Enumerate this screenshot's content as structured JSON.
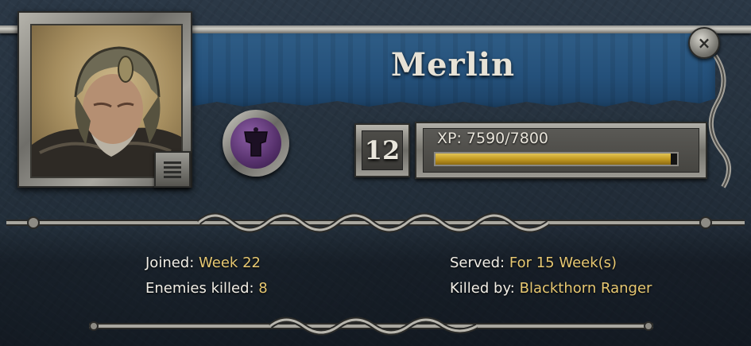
{
  "hero": {
    "name": "Merlin",
    "level": "12",
    "xp_label": "XP: 7590/7800",
    "xp_current": 7590,
    "xp_max": 7800,
    "xp_fraction": 0.973,
    "class_icon": "mage-robe-icon"
  },
  "stats": {
    "joined_label": "Joined:",
    "joined_value": "Week 22",
    "enemies_label": "Enemies killed:",
    "enemies_value": "8",
    "served_label": "Served:",
    "served_value": "For 15 Week(s)",
    "killed_by_label": "Killed by:",
    "killed_by_value": "Blackthorn Ranger"
  },
  "controls": {
    "close_symbol": "×",
    "menu_icon": "list-icon"
  },
  "colors": {
    "banner": "#24507a",
    "value_text": "#e7c872",
    "xp_fill": "#c39a22",
    "emblem": "#55306b"
  }
}
